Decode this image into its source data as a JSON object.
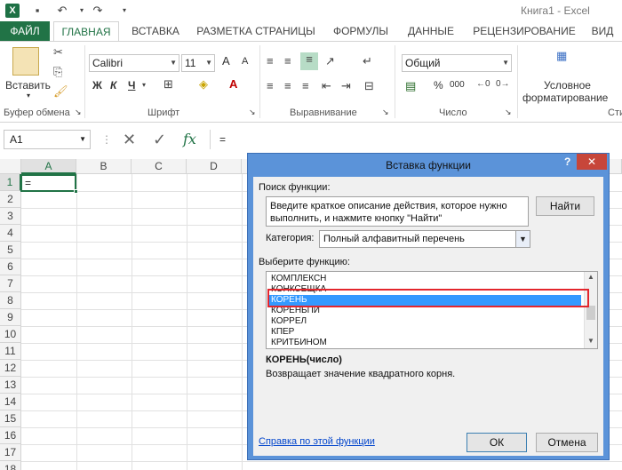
{
  "window": {
    "title": "Книга1 - Excel"
  },
  "ribbon": {
    "tabs": [
      "ФАЙЛ",
      "ГЛАВНАЯ",
      "ВСТАВКА",
      "РАЗМЕТКА СТРАНИЦЫ",
      "ФОРМУЛЫ",
      "ДАННЫЕ",
      "РЕЦЕНЗИРОВАНИЕ",
      "ВИД"
    ],
    "active_tab": "ГЛАВНАЯ",
    "clipboard": {
      "paste_label": "Вставить",
      "group_label": "Буфер обмена"
    },
    "font": {
      "name": "Calibri",
      "size": "11",
      "bold": "Ж",
      "italic": "К",
      "underline": "Ч",
      "group_label": "Шрифт",
      "grow": "A",
      "shrink": "A"
    },
    "alignment": {
      "group_label": "Выравнивание"
    },
    "number": {
      "format": "Общий",
      "percent": "%",
      "thousands": "000",
      "group_label": "Число"
    },
    "styles": {
      "conditional_label_1": "Условное",
      "conditional_label_2": "форматирование",
      "group_label": "Сти"
    }
  },
  "formula_bar": {
    "name_box": "A1",
    "fx": "fx",
    "value": "="
  },
  "grid": {
    "columns": [
      "A",
      "B",
      "C",
      "D"
    ],
    "rows": [
      "1",
      "2",
      "3",
      "4",
      "5",
      "6",
      "7",
      "8",
      "9",
      "10",
      "11",
      "12",
      "13",
      "14",
      "15",
      "16",
      "17",
      "18"
    ],
    "active_cell_value": "="
  },
  "dialog": {
    "title": "Вставка функции",
    "help": "?",
    "close": "✕",
    "search_label": "Поиск функции:",
    "search_text": "Введите краткое описание действия, которое нужно выполнить, и нажмите кнопку \"Найти\"",
    "find_button": "Найти",
    "category_label": "Категория:",
    "category_value": "Полный алфавитный перечень",
    "choose_label": "Выберите функцию:",
    "functions": [
      "КОМПЛЕКСН",
      "КОНКСЕЩКА",
      "КОРЕНЬ",
      "КОРЕНЬПИ",
      "КОРРЕЛ",
      "КПЕР",
      "КРИТБИНОМ"
    ],
    "selected_function": "КОРЕНЬ",
    "signature": "КОРЕНЬ(число)",
    "description": "Возвращает значение квадратного корня.",
    "help_link": "Справка по этой функции",
    "ok_button": "ОК",
    "cancel_button": "Отмена"
  }
}
